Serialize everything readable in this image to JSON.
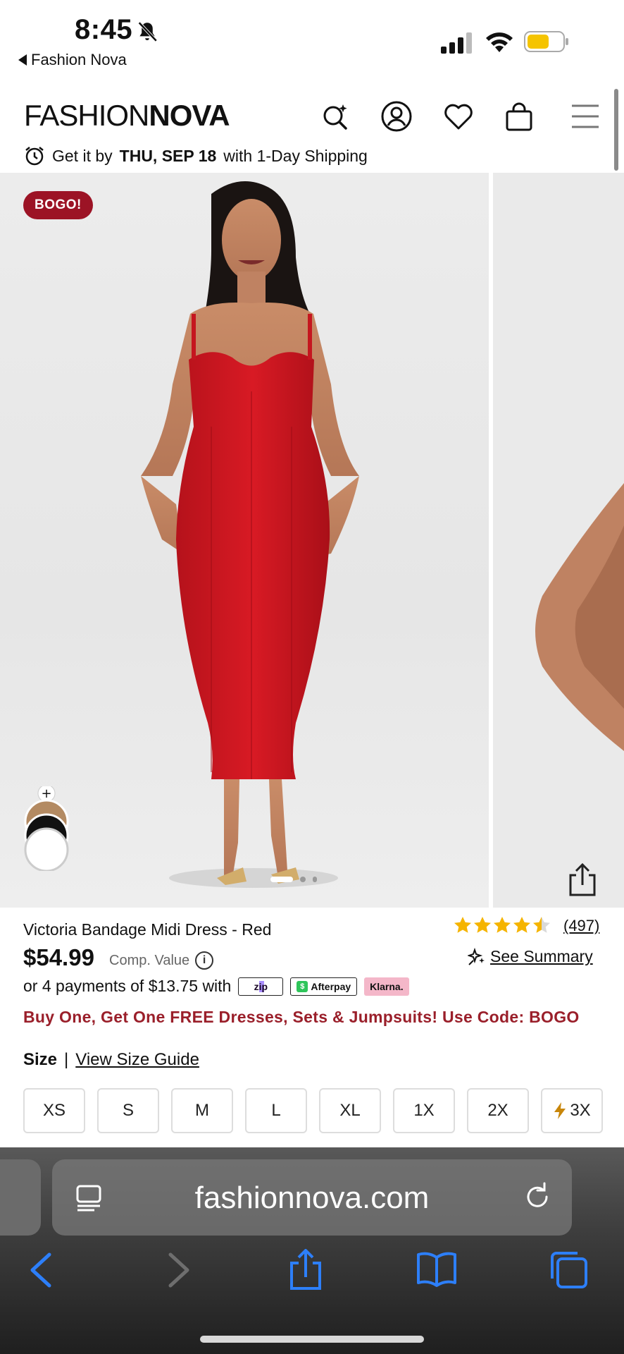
{
  "status_bar": {
    "time": "8:45",
    "back_app": "Fashion Nova"
  },
  "header": {
    "logo_light": "FASHION",
    "logo_bold": "NOVA",
    "shipping_prefix": "Get it by",
    "shipping_date": "THU, SEP 18",
    "shipping_suffix": "with 1-Day Shipping"
  },
  "gallery": {
    "badge": "BOGO!",
    "swatch_add": "+",
    "active_image": 1,
    "image_count": 3
  },
  "product": {
    "name": "Victoria Bandage Midi Dress - Red",
    "rating": 4.5,
    "review_count": "(497)",
    "price": "$54.99",
    "comp_value_label": "Comp. Value",
    "see_summary": "See Summary",
    "payments_text": "or 4 payments of $13.75 with",
    "pay_zip": "zip",
    "pay_afterpay": "Afterpay",
    "pay_klarna": "Klarna.",
    "promo": "Buy One, Get One FREE Dresses, Sets & Jumpsuits! Use Code: BOGO",
    "size_label": "Size",
    "size_guide": "View Size Guide",
    "sizes": [
      "XS",
      "S",
      "M",
      "L",
      "XL",
      "1X",
      "2X",
      "3X"
    ]
  },
  "browser": {
    "url": "fashionnova.com"
  },
  "colors": {
    "accent_red": "#9c1325",
    "promo_red": "#9a1f2a",
    "star_gold": "#f5b400"
  }
}
